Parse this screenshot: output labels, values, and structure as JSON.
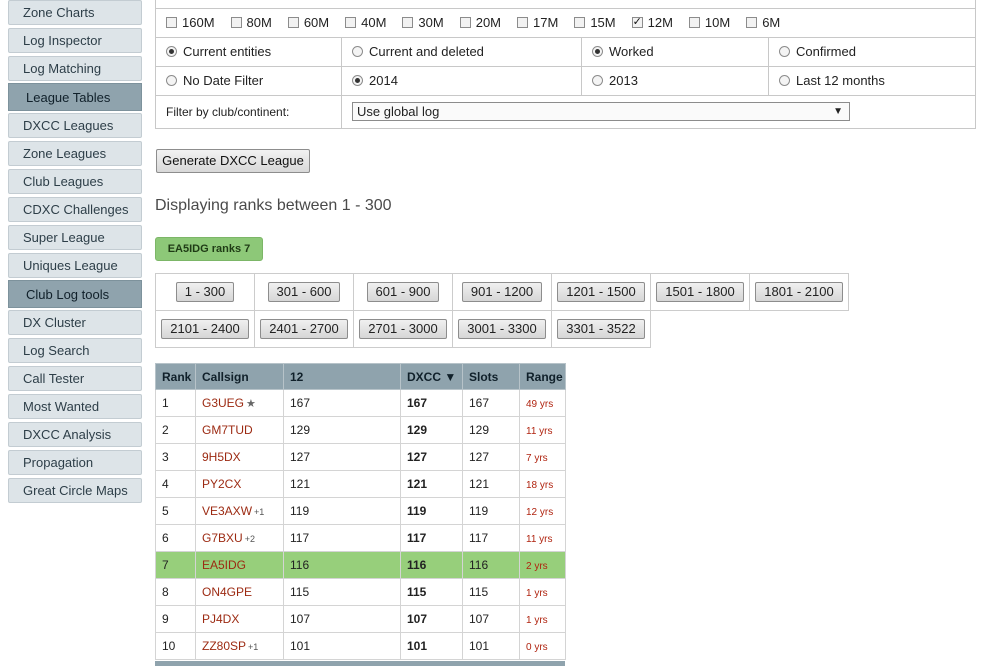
{
  "sidebar": {
    "items": [
      {
        "label": "Zone Charts",
        "type": "item"
      },
      {
        "label": "Log Inspector",
        "type": "item"
      },
      {
        "label": "Log Matching",
        "type": "item"
      },
      {
        "label": "League Tables",
        "type": "section"
      },
      {
        "label": "DXCC Leagues",
        "type": "item"
      },
      {
        "label": "Zone Leagues",
        "type": "item"
      },
      {
        "label": "Club Leagues",
        "type": "item"
      },
      {
        "label": "CDXC Challenges",
        "type": "item"
      },
      {
        "label": "Super League",
        "type": "item"
      },
      {
        "label": "Uniques League",
        "type": "item"
      },
      {
        "label": "Club Log tools",
        "type": "section"
      },
      {
        "label": "DX Cluster",
        "type": "item"
      },
      {
        "label": "Log Search",
        "type": "item"
      },
      {
        "label": "Call Tester",
        "type": "item"
      },
      {
        "label": "Most Wanted",
        "type": "item"
      },
      {
        "label": "DXCC Analysis",
        "type": "item"
      },
      {
        "label": "Propagation",
        "type": "item"
      },
      {
        "label": "Great Circle Maps",
        "type": "item"
      }
    ]
  },
  "filters": {
    "bands": [
      {
        "label": "160M",
        "checked": false
      },
      {
        "label": "80M",
        "checked": false
      },
      {
        "label": "60M",
        "checked": false
      },
      {
        "label": "40M",
        "checked": false
      },
      {
        "label": "30M",
        "checked": false
      },
      {
        "label": "20M",
        "checked": false
      },
      {
        "label": "17M",
        "checked": false
      },
      {
        "label": "15M",
        "checked": false
      },
      {
        "label": "12M",
        "checked": true
      },
      {
        "label": "10M",
        "checked": false
      },
      {
        "label": "6M",
        "checked": false
      }
    ],
    "entity_options": [
      {
        "label": "Current entities",
        "checked": true
      },
      {
        "label": "Current and deleted",
        "checked": false
      },
      {
        "label": "Worked",
        "checked": true
      },
      {
        "label": "Confirmed",
        "checked": false
      }
    ],
    "date_options": [
      {
        "label": "No Date Filter",
        "checked": false
      },
      {
        "label": "2014",
        "checked": true
      },
      {
        "label": "2013",
        "checked": false
      },
      {
        "label": "Last 12 months",
        "checked": false
      }
    ],
    "club_label": "Filter by club/continent:",
    "club_value": "Use global log"
  },
  "generate_button": "Generate DXCC League",
  "display_text": "Displaying ranks between 1 - 300",
  "rank_badge": "EA5IDG ranks 7",
  "pagination": [
    [
      "1 - 300",
      "301 - 600",
      "601 - 900",
      "901 - 1200",
      "1201 - 1500",
      "1501 - 1800",
      "1801 - 2100"
    ],
    [
      "2101 - 2400",
      "2401 - 2700",
      "2701 - 3000",
      "3001 - 3300",
      "3301 - 3522"
    ]
  ],
  "table": {
    "headers": [
      "Rank",
      "Callsign",
      "12",
      "DXCC ▼",
      "Slots",
      "Range"
    ],
    "rows": [
      {
        "rank": "1",
        "call": "G3UEG",
        "suffix": "★",
        "band": "167",
        "dxcc": "167",
        "slots": "167",
        "range": "49 yrs",
        "highlight": false
      },
      {
        "rank": "2",
        "call": "GM7TUD",
        "suffix": "",
        "band": "129",
        "dxcc": "129",
        "slots": "129",
        "range": "11 yrs",
        "highlight": false
      },
      {
        "rank": "3",
        "call": "9H5DX",
        "suffix": "",
        "band": "127",
        "dxcc": "127",
        "slots": "127",
        "range": "7 yrs",
        "highlight": false
      },
      {
        "rank": "4",
        "call": "PY2CX",
        "suffix": "",
        "band": "121",
        "dxcc": "121",
        "slots": "121",
        "range": "18 yrs",
        "highlight": false
      },
      {
        "rank": "5",
        "call": "VE3AXW",
        "suffix": "+1",
        "band": "119",
        "dxcc": "119",
        "slots": "119",
        "range": "12 yrs",
        "highlight": false
      },
      {
        "rank": "6",
        "call": "G7BXU",
        "suffix": "+2",
        "band": "117",
        "dxcc": "117",
        "slots": "117",
        "range": "11 yrs",
        "highlight": false
      },
      {
        "rank": "7",
        "call": "EA5IDG",
        "suffix": "",
        "band": "116",
        "dxcc": "116",
        "slots": "116",
        "range": "2 yrs",
        "highlight": true
      },
      {
        "rank": "8",
        "call": "ON4GPE",
        "suffix": "",
        "band": "115",
        "dxcc": "115",
        "slots": "115",
        "range": "1 yrs",
        "highlight": false
      },
      {
        "rank": "9",
        "call": "PJ4DX",
        "suffix": "",
        "band": "107",
        "dxcc": "107",
        "slots": "107",
        "range": "1 yrs",
        "highlight": false
      },
      {
        "rank": "10",
        "call": "ZZ80SP",
        "suffix": "+1",
        "band": "101",
        "dxcc": "101",
        "slots": "101",
        "range": "0 yrs",
        "highlight": false
      }
    ]
  }
}
